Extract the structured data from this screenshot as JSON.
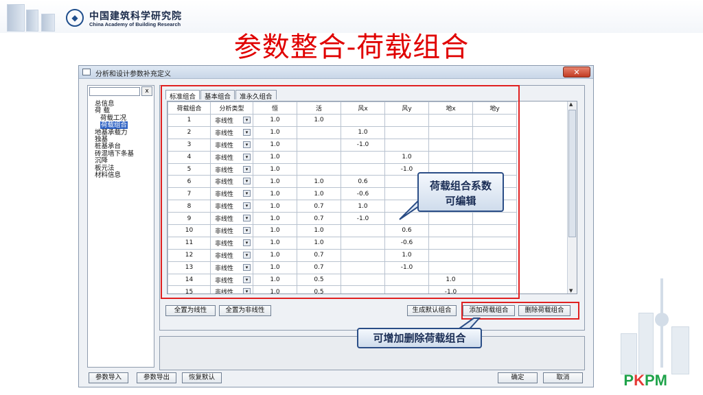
{
  "header": {
    "org_cn": "中国建筑科学研究院",
    "org_en": "China Academy of Building Research",
    "slide_title": "参数整合-荷载组合"
  },
  "dialog": {
    "title": "分析和设计参数补充定义",
    "close_label": "✕",
    "search_clear": "x",
    "tree": [
      {
        "label": "总信息",
        "level": 0
      },
      {
        "label": "荷  载",
        "level": 0
      },
      {
        "label": "荷载工况",
        "level": 1
      },
      {
        "label": "荷载组合",
        "level": 1,
        "selected": true
      },
      {
        "label": "地基承载力",
        "level": 0
      },
      {
        "label": "独基",
        "level": 0
      },
      {
        "label": "桩基承台",
        "level": 0
      },
      {
        "label": "砖混墙下条基",
        "level": 0
      },
      {
        "label": "沉降",
        "level": 0
      },
      {
        "label": "板元法",
        "level": 0
      },
      {
        "label": "材料信息",
        "level": 0
      }
    ],
    "tabs": [
      "标准组合",
      "基本组合",
      "准永久组合"
    ],
    "columns": [
      "荷载组合",
      "分析类型",
      "恒",
      "活",
      "风x",
      "风y",
      "地x",
      "地y"
    ],
    "rows": [
      [
        "1",
        "非线性",
        "1.0",
        "1.0",
        "",
        "",
        "",
        ""
      ],
      [
        "2",
        "非线性",
        "1.0",
        "",
        "1.0",
        "",
        "",
        ""
      ],
      [
        "3",
        "非线性",
        "1.0",
        "",
        "-1.0",
        "",
        "",
        ""
      ],
      [
        "4",
        "非线性",
        "1.0",
        "",
        "",
        "1.0",
        "",
        ""
      ],
      [
        "5",
        "非线性",
        "1.0",
        "",
        "",
        "-1.0",
        "",
        ""
      ],
      [
        "6",
        "非线性",
        "1.0",
        "1.0",
        "0.6",
        "",
        "",
        ""
      ],
      [
        "7",
        "非线性",
        "1.0",
        "1.0",
        "-0.6",
        "",
        "",
        ""
      ],
      [
        "8",
        "非线性",
        "1.0",
        "0.7",
        "1.0",
        "",
        "",
        ""
      ],
      [
        "9",
        "非线性",
        "1.0",
        "0.7",
        "-1.0",
        "",
        "",
        ""
      ],
      [
        "10",
        "非线性",
        "1.0",
        "1.0",
        "",
        "0.6",
        "",
        ""
      ],
      [
        "11",
        "非线性",
        "1.0",
        "1.0",
        "",
        "-0.6",
        "",
        ""
      ],
      [
        "12",
        "非线性",
        "1.0",
        "0.7",
        "",
        "1.0",
        "",
        ""
      ],
      [
        "13",
        "非线性",
        "1.0",
        "0.7",
        "",
        "-1.0",
        "",
        ""
      ],
      [
        "14",
        "非线性",
        "1.0",
        "0.5",
        "",
        "",
        "1.0",
        ""
      ],
      [
        "15",
        "非线性",
        "1.0",
        "0.5",
        "",
        "",
        "-1.0",
        ""
      ]
    ],
    "buttons": {
      "all_linear": "全置为线性",
      "all_nonlinear": "全置为非线性",
      "gen_default": "生成默认组合",
      "add_combo": "添加荷载组合",
      "del_combo": "删除荷载组合",
      "import_params": "参数导入",
      "export_params": "参数导出",
      "restore_default": "恢复默认",
      "ok": "确定",
      "cancel": "取消"
    }
  },
  "callouts": {
    "editable": [
      "荷载组合系数",
      "可编辑"
    ],
    "add_delete": "可增加删除荷载组合"
  },
  "logo_text": "PKPM"
}
